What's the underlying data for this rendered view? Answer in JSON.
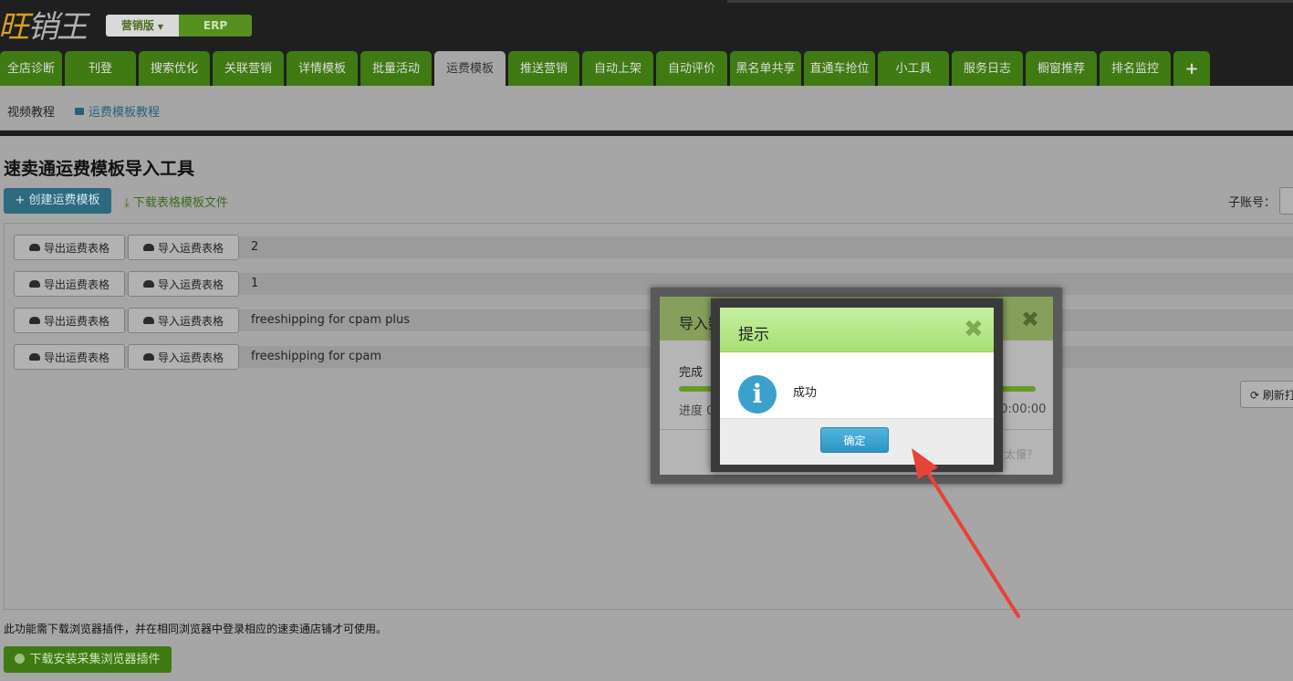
{
  "header": {
    "logo_text": "旺销王",
    "edition_label": "营销版",
    "erp_label": "ERP"
  },
  "nav": {
    "tabs": [
      "全店诊断",
      "刊登",
      "搜索优化",
      "关联营销",
      "详情模板",
      "批量活动",
      "运费模板",
      "推送营销",
      "自动上架",
      "自动评价",
      "黑名单共享",
      "直通车抢位",
      "小工具",
      "服务日志",
      "橱窗推荐",
      "排名监控"
    ],
    "active_tab": "运费模板",
    "add_icon": "plus-icon"
  },
  "subnav": {
    "video_label": "视频教程",
    "tutorial_link": "运费模板教程"
  },
  "main": {
    "title": "速卖通运费模板导入工具",
    "create_button": "创建运费模板",
    "download_template_link": "下载表格模板文件",
    "subaccount_label": "子账号：",
    "export_label": "导出运费表格",
    "import_label": "导入运费表格",
    "templates": [
      "2",
      "1",
      "freeshipping for cpam plus",
      "freeshipping for cpam"
    ],
    "refresh_button": "刷新打",
    "footer_note": "此功能需下载浏览器插件，并在相同浏览器中登录相应的速卖通店铺才可使用。",
    "plugin_button": "下载安装采集浏览器插件"
  },
  "import_dialog": {
    "title": "导入数",
    "status": "完成",
    "progress_label": "进度 0/0",
    "progress": 1.0,
    "timer": "00:00:00",
    "slow_hint": "度太慢？"
  },
  "alert_dialog": {
    "title": "提示",
    "message": "成功",
    "ok_button": "确定",
    "info_icon": "info-icon",
    "close_icon": "close-icon"
  },
  "colors": {
    "nav_green": "#3f7a13",
    "alert_header": "#b4e68a",
    "ok_button": "#3aa0cc",
    "arrow": "#e8423a"
  }
}
